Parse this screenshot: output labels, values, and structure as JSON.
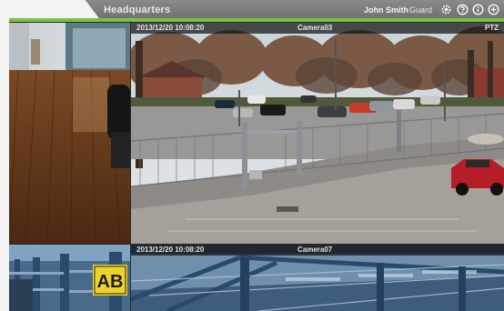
{
  "header": {
    "title": "Headquarters",
    "user_name": "John Smith",
    "user_role": "Guard",
    "icons": [
      "gear-icon",
      "help-icon",
      "info-icon",
      "add-icon"
    ]
  },
  "tiles": {
    "main": {
      "timestamp": "2013/12/20  10:08:20",
      "camera": "Camera03",
      "ptz_label": "PTZ"
    },
    "bottom": {
      "timestamp": "2013/12/20  10:08:20",
      "camera": "Camera07"
    },
    "warehouse_sign": "AB"
  },
  "colors": {
    "accent": "#7cc242",
    "header_bg": "#7a7a7a",
    "overlay": "#1a1a1a"
  }
}
